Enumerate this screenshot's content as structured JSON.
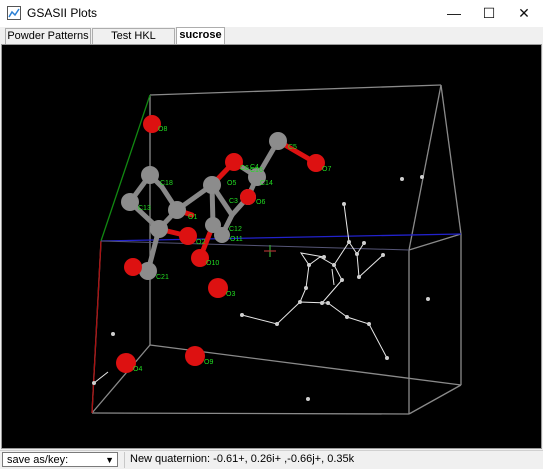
{
  "window": {
    "title": "GSASII Plots",
    "minimize": "—",
    "maximize": "☐",
    "close": "✕"
  },
  "tabs": [
    {
      "label": "Powder Patterns",
      "active": false
    },
    {
      "label": "Test HKL phases",
      "active": false
    },
    {
      "label": "sucrose",
      "active": true
    }
  ],
  "statusbar": {
    "save_label": "save as/key:",
    "message": "New quaternion: -0.61+, 0.26i+ ,-0.66j+, 0.35k"
  },
  "atom_labels": [
    "O8",
    "C5",
    "O7",
    "C6",
    "C4",
    "O6",
    "O5",
    "C3",
    "O4",
    "O3",
    "O2",
    "O10",
    "O11",
    "C12",
    "C13",
    "C14",
    "C16",
    "C18",
    "C21",
    "O1",
    "O9"
  ],
  "colors": {
    "oxygen": "#dd1111",
    "carbon": "#888888",
    "background": "#000000",
    "accent": "#22dd22"
  }
}
